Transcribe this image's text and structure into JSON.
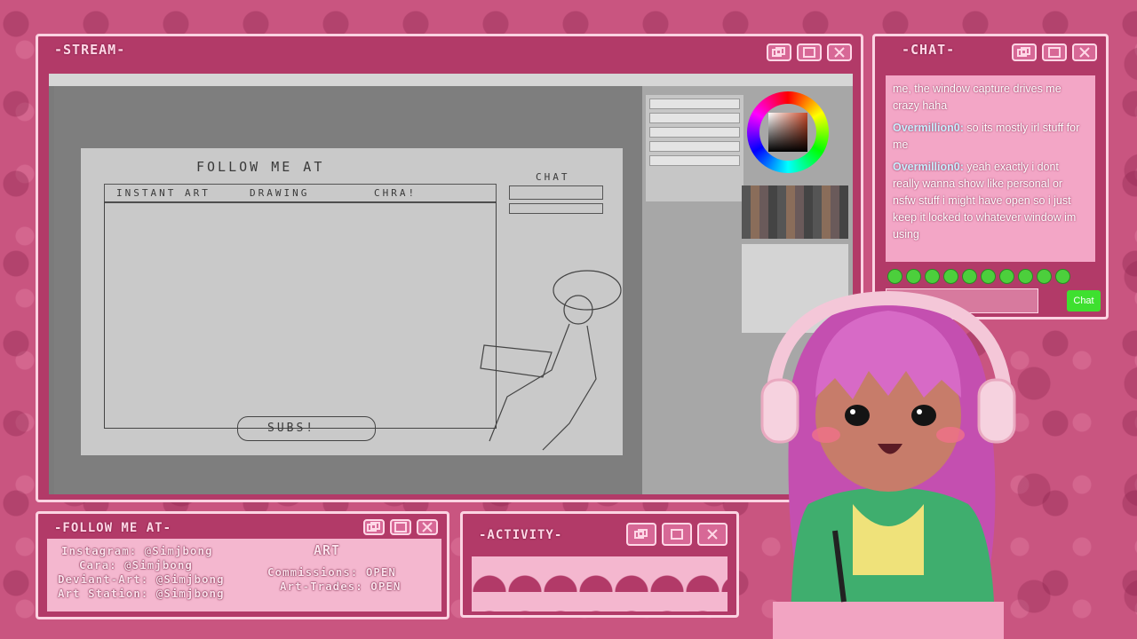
{
  "stream": {
    "title": "-STREAM-",
    "sketch": {
      "header": "FOLLOW ME AT",
      "tabs": [
        "INSTANT ART",
        "DRAWING",
        "CHRA!"
      ],
      "chat_label": "CHAT",
      "bottom_label": "SUBS!"
    }
  },
  "chat": {
    "title": "-CHAT-",
    "messages": [
      {
        "user": "",
        "text": "me, the window capture drives me crazy haha"
      },
      {
        "user": "Overmillion0:",
        "text": " so its mostly irl stuff for me"
      },
      {
        "user": "Overmillion0:",
        "text": " yeah exactly i dont really wanna show like personal or nsfw stuff i might have open so i just keep it locked to whatever window im using"
      }
    ],
    "send_label": "Chat"
  },
  "follow": {
    "title": "-FOLLOW ME AT-",
    "lines": [
      "Instagram: @Simjbong",
      "Cara: @Simjbong",
      "Deviant-Art: @Simjbong",
      "Art Station: @Simjbong"
    ],
    "art_heading": "ART",
    "commissions": "Commissions: OPEN",
    "art_trades": "Art-Trades: OPEN"
  },
  "activity": {
    "title": "-ACTIVITY-"
  },
  "colors": {
    "frame": "#b23a68",
    "border": "#fbd3e2",
    "chat_accent": "#c8f0ff",
    "emote_green": "#4ccf3c"
  }
}
